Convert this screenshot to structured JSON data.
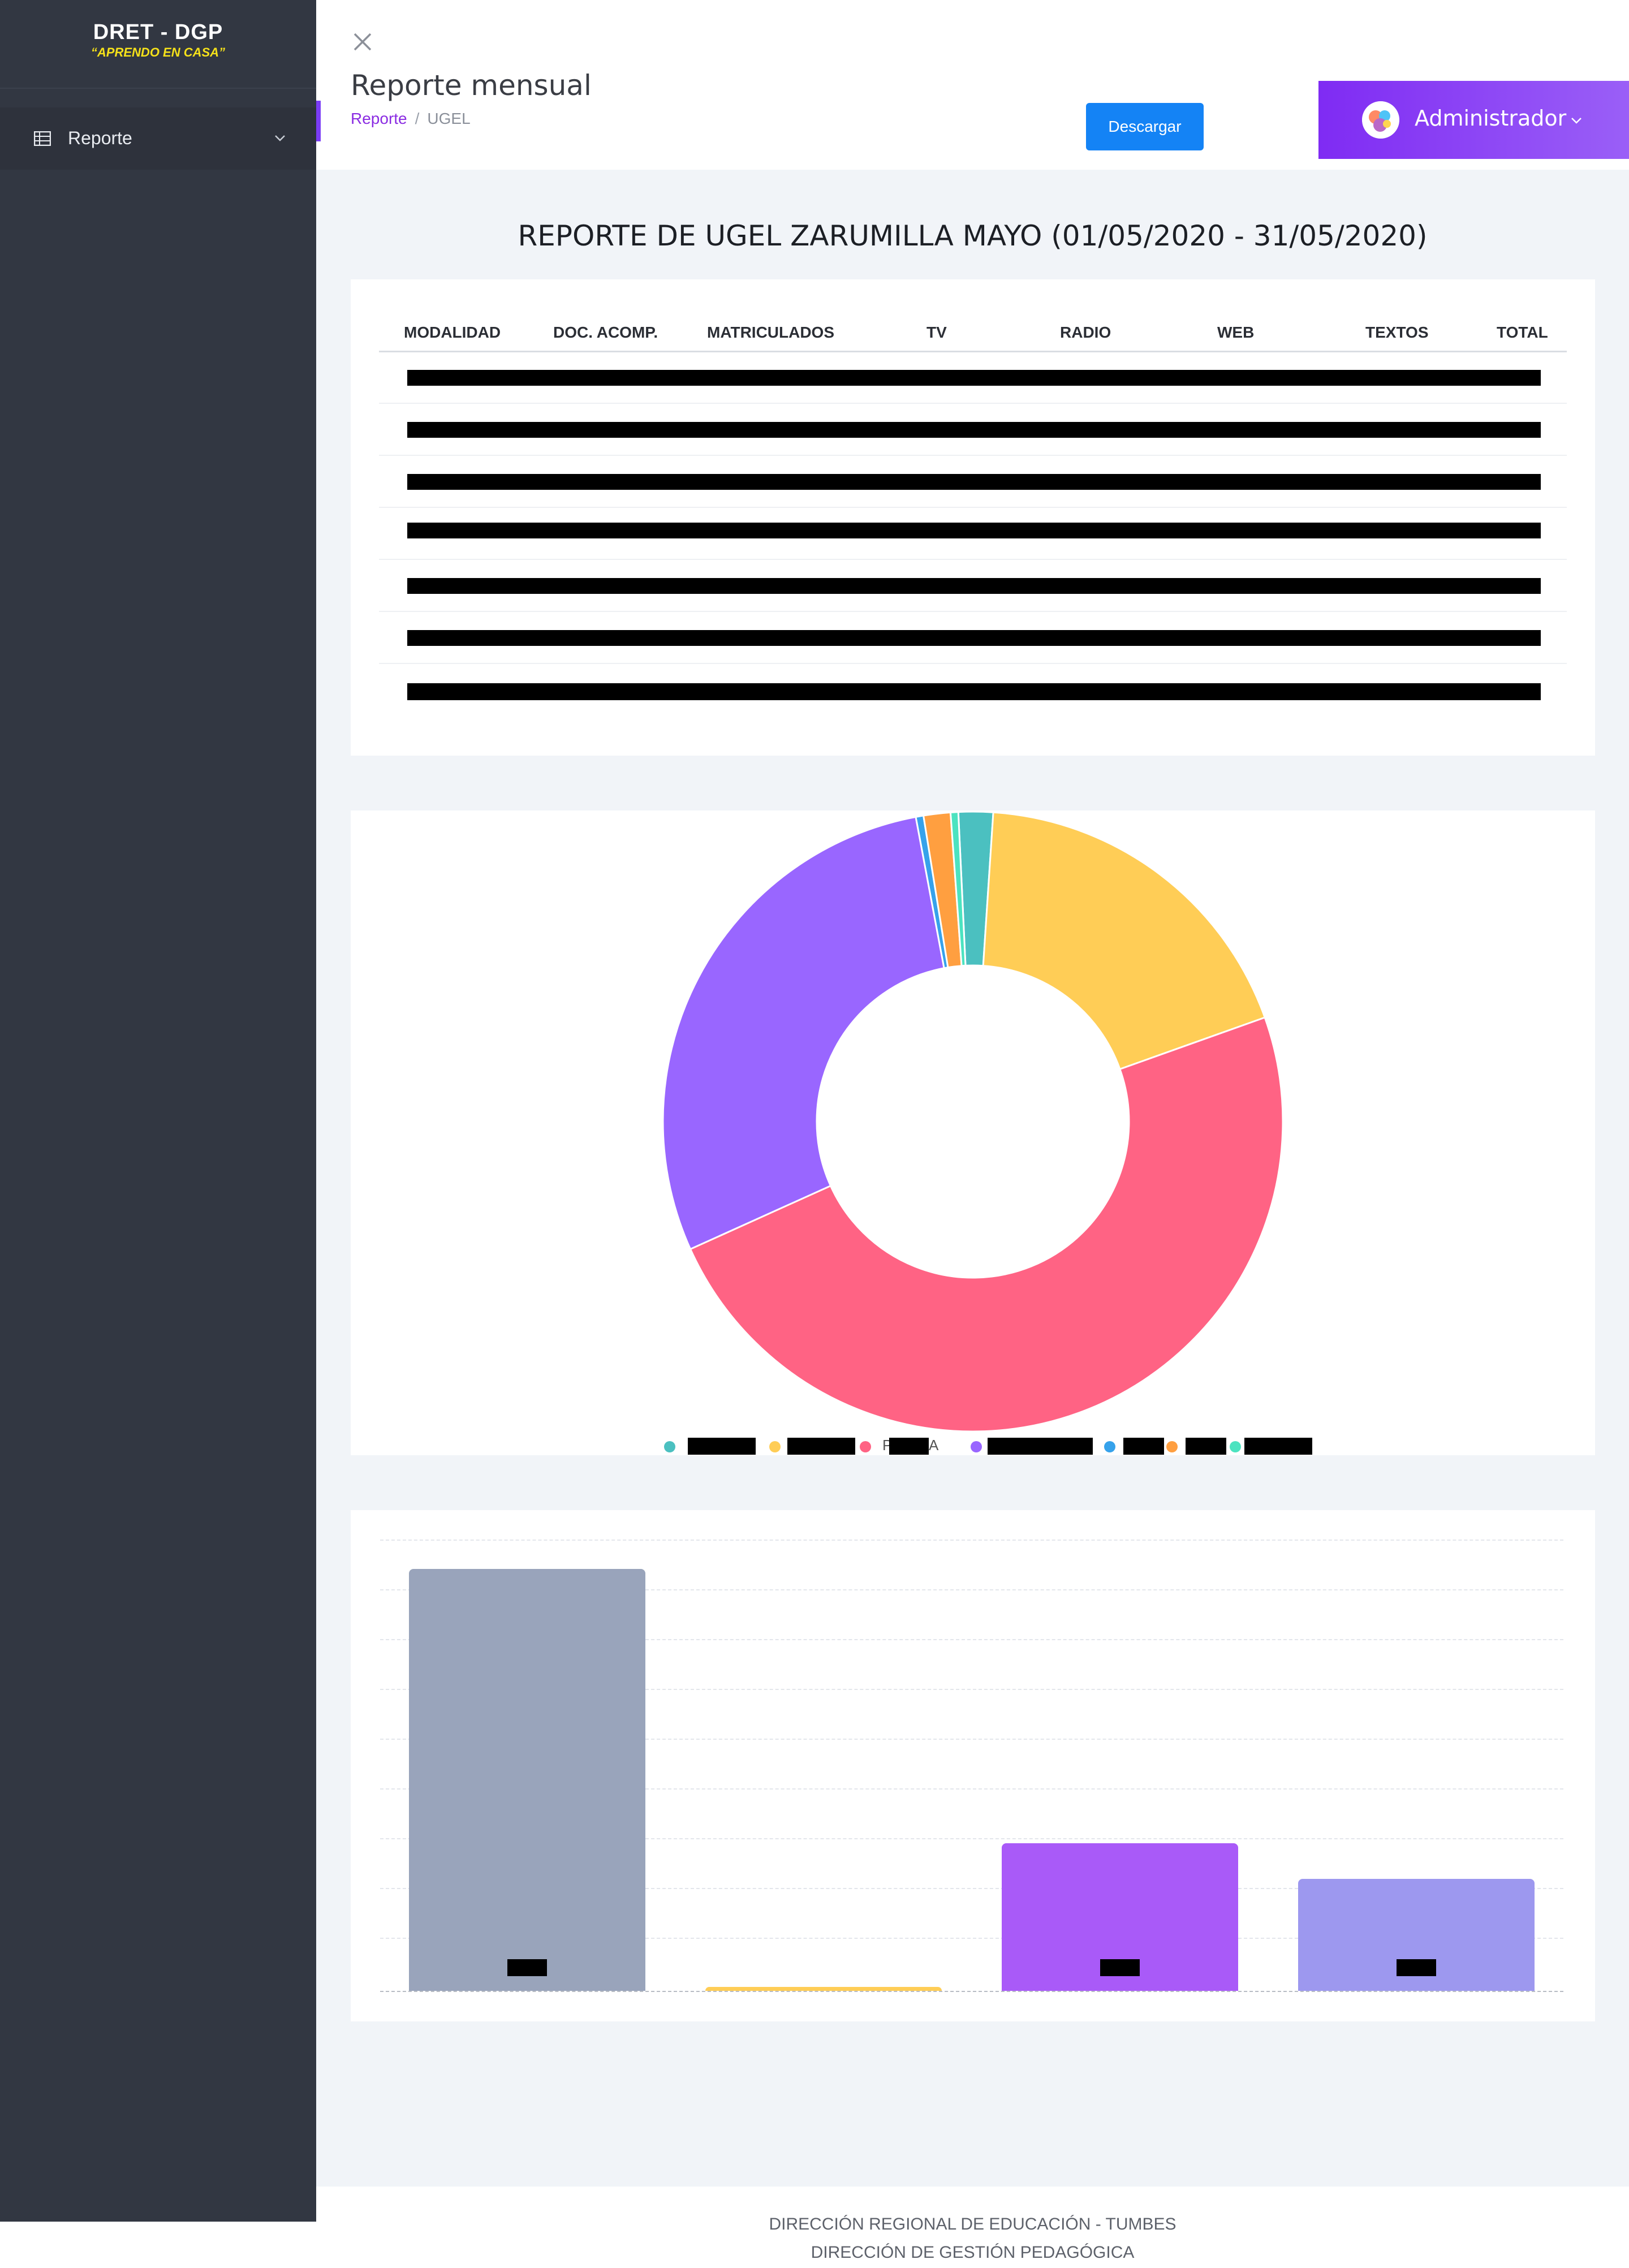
{
  "brand": {
    "title": "DRET - DGP",
    "subtitle": "“APRENDO EN CASA”"
  },
  "sidebar": {
    "items": [
      {
        "label": "Reporte",
        "icon": "table-icon"
      }
    ]
  },
  "header": {
    "page_title": "Reporte mensual",
    "breadcrumb": [
      "Reporte",
      "UGEL"
    ],
    "download_label": "Descargar",
    "user_label": "Administrador"
  },
  "report": {
    "title": "REPORTE DE UGEL ZARUMILLA MAYO (01/05/2020 - 31/05/2020)",
    "columns": [
      "MODALIDAD",
      "DOC. ACOMP.",
      "MATRICULADOS",
      "TV",
      "RADIO",
      "WEB",
      "TEXTOS",
      "TOTAL"
    ],
    "rows_redacted": 7
  },
  "chart_data": [
    {
      "type": "pie",
      "donut": true,
      "slices": [
        {
          "color": "#4bc0c0",
          "value": 1.8
        },
        {
          "color": "#ffcd56",
          "value": 18.5
        },
        {
          "color": "#ff6384",
          "value": 48.7
        },
        {
          "color": "#9966ff",
          "value": 28.8
        },
        {
          "color": "#36a2eb",
          "value": 0.4
        },
        {
          "color": "#ff9f40",
          "value": 1.4
        },
        {
          "color": "#4ce3c0",
          "value": 0.4
        }
      ],
      "legend_position": "bottom",
      "legend_labels_redacted": true,
      "legend_fragments": [
        "P",
        "A"
      ]
    },
    {
      "type": "bar",
      "values": [
        100,
        1,
        35,
        26.5
      ],
      "colors": [
        "#99a4bb",
        "#ffcd56",
        "#a95af8",
        "#9d98ef"
      ],
      "ylim": [
        0,
        107
      ],
      "grid": true,
      "labels_redacted": true
    }
  ],
  "footer": {
    "line1": "DIRECCIÓN REGIONAL DE EDUCACIÓN - TUMBES",
    "line2": "DIRECCIÓN DE GESTIÓN PEDAGÓGICA"
  }
}
